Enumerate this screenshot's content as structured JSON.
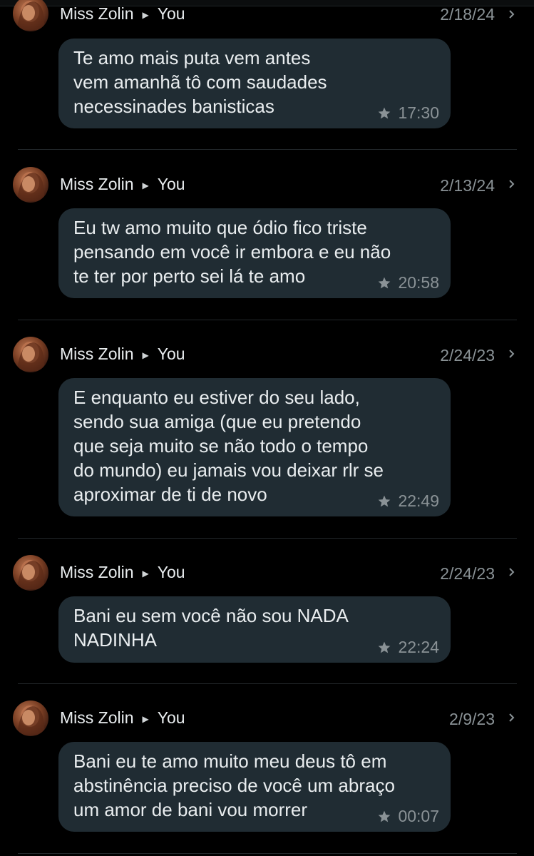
{
  "starred_messages": [
    {
      "sender": "Miss Zolin",
      "recipient": "You",
      "date": "2/18/24",
      "text": "Te amo mais puta vem antes\nvem amanhã tô com saudades\nnecessinades banisticas",
      "time": "17:30",
      "avatar_icon": "contact-photo",
      "star_icon": "star-icon"
    },
    {
      "sender": "Miss Zolin",
      "recipient": "You",
      "date": "2/13/24",
      "text": "Eu tw amo muito que ódio fico triste\npensando em você ir embora e eu não\nte ter por perto sei lá te amo",
      "time": "20:58",
      "avatar_icon": "contact-photo",
      "star_icon": "star-icon"
    },
    {
      "sender": "Miss Zolin",
      "recipient": "You",
      "date": "2/24/23",
      "text": "E enquanto eu estiver do seu lado,\nsendo sua amiga (que eu pretendo\nque seja muito se não todo o tempo\ndo mundo) eu jamais vou deixar rlr se\naproximar de ti de novo",
      "time": "22:49",
      "avatar_icon": "contact-photo",
      "star_icon": "star-icon"
    },
    {
      "sender": "Miss Zolin",
      "recipient": "You",
      "date": "2/24/23",
      "text": "Bani eu sem você não sou NADA\nNADINHA",
      "time": "22:24",
      "avatar_icon": "contact-photo",
      "star_icon": "star-icon"
    },
    {
      "sender": "Miss Zolin",
      "recipient": "You",
      "date": "2/9/23",
      "text": "Bani eu te amo muito meu deus tô em\nabstinência preciso de você um abraço\num amor de bani vou morrer",
      "time": "00:07",
      "avatar_icon": "contact-photo",
      "star_icon": "star-icon"
    }
  ],
  "colors": {
    "background": "#000000",
    "bubble": "#202c33",
    "primary_text": "#e9edef",
    "secondary_text": "#8a9296",
    "divider": "#23282b"
  }
}
